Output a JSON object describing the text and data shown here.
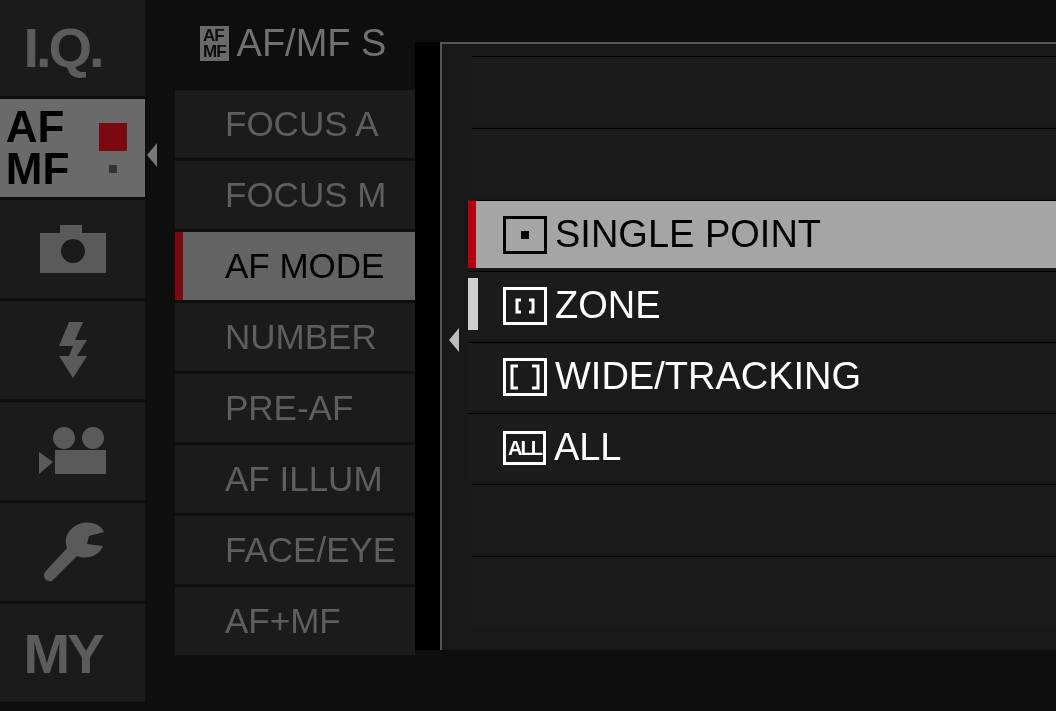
{
  "sidebar": {
    "tabs": [
      {
        "kind": "text",
        "label": "I.Q.",
        "selected": false
      },
      {
        "kind": "afmf",
        "lines": [
          "AF",
          "MF"
        ],
        "selected": true,
        "pages": [
          {
            "selected": true
          },
          {
            "selected": false
          }
        ]
      },
      {
        "kind": "camera",
        "selected": false
      },
      {
        "kind": "flash",
        "selected": false
      },
      {
        "kind": "movie",
        "selected": false
      },
      {
        "kind": "wrench",
        "selected": false
      },
      {
        "kind": "text",
        "label": "MY",
        "selected": false
      }
    ]
  },
  "menu": {
    "header": {
      "icon_lines": [
        "AF",
        "MF"
      ],
      "title": "AF/MF S"
    },
    "items": [
      {
        "label": "FOCUS A",
        "selected": false
      },
      {
        "label": "FOCUS M",
        "selected": false
      },
      {
        "label": "AF MODE",
        "selected": true
      },
      {
        "label": "NUMBER",
        "selected": false
      },
      {
        "label": "PRE-AF",
        "selected": false
      },
      {
        "label": "AF ILLUM",
        "selected": false
      },
      {
        "label": "FACE/EYE",
        "selected": false
      },
      {
        "label": "AF+MF",
        "selected": false
      }
    ]
  },
  "popup": {
    "options": [
      {
        "kind": "single",
        "label": "SINGLE POINT",
        "selected": true
      },
      {
        "kind": "zone",
        "label": "ZONE",
        "selected": false
      },
      {
        "kind": "wide",
        "label": "WIDE/TRACKING",
        "selected": false
      },
      {
        "kind": "all",
        "icon_text": "ALL",
        "label": "ALL",
        "selected": false
      }
    ]
  }
}
